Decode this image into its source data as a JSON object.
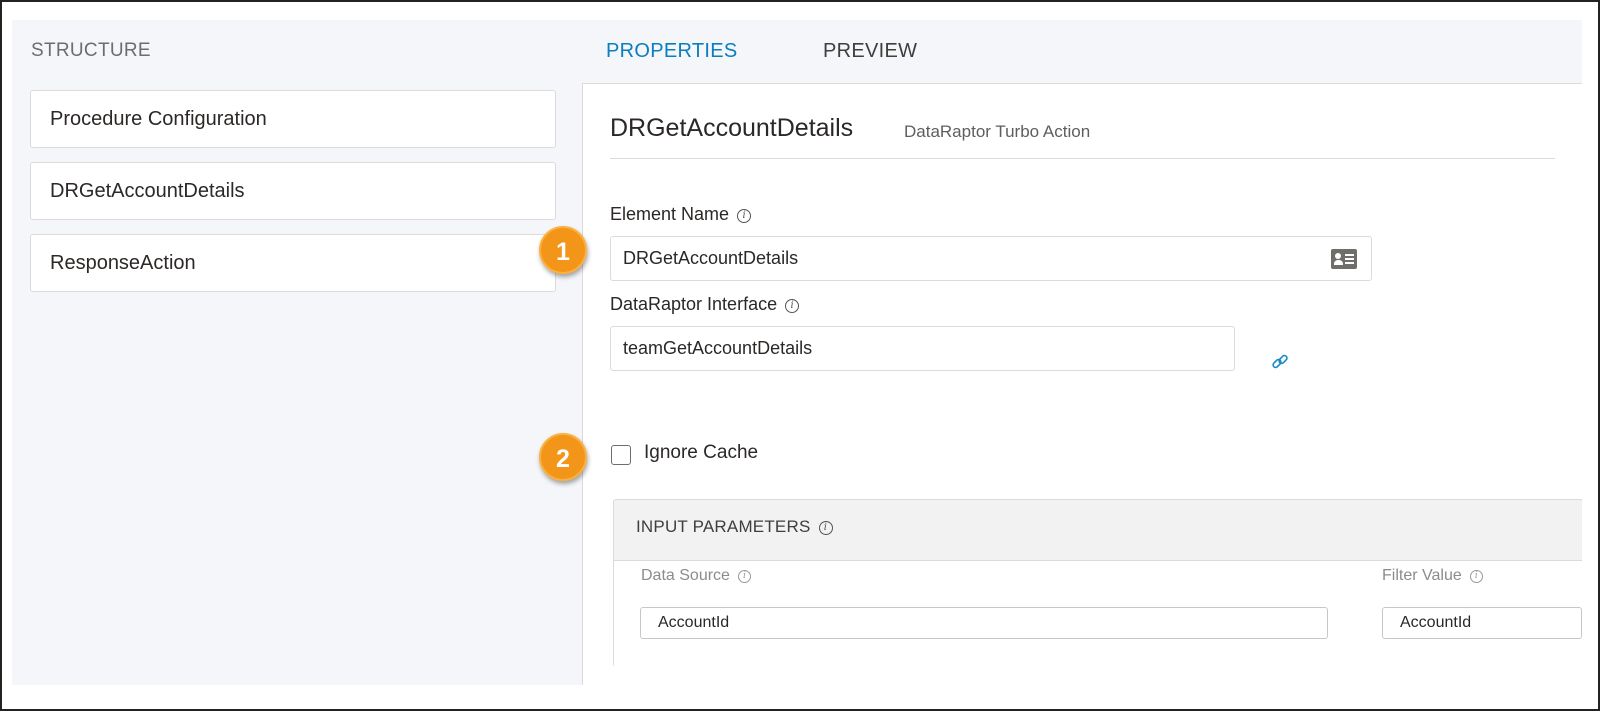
{
  "structure": {
    "title": "STRUCTURE",
    "items": [
      {
        "label": "Procedure Configuration"
      },
      {
        "label": "DRGetAccountDetails"
      },
      {
        "label": "ResponseAction"
      }
    ]
  },
  "tabs": [
    {
      "label": "PROPERTIES",
      "active": true
    },
    {
      "label": "PREVIEW",
      "active": false
    }
  ],
  "element": {
    "title": "DRGetAccountDetails",
    "subtitle": "DataRaptor Turbo Action",
    "element_name_label": "Element Name",
    "element_name_value": "DRGetAccountDetails",
    "interface_label": "DataRaptor Interface",
    "interface_value": "teamGetAccountDetails",
    "ignore_cache_label": "Ignore Cache",
    "ignore_cache_checked": false
  },
  "input_parameters": {
    "title": "INPUT PARAMETERS",
    "columns": [
      "Data Source",
      "Filter Value"
    ],
    "rows": [
      {
        "data_source": "AccountId",
        "filter_value": "AccountId"
      }
    ]
  },
  "callouts": [
    "1",
    "2"
  ],
  "colors": {
    "accent": "#0a7ebe",
    "callout": "#f39519",
    "panel_bg": "#f4f6f9"
  },
  "icons": [
    "info-icon",
    "contact-card-icon",
    "link-icon"
  ]
}
